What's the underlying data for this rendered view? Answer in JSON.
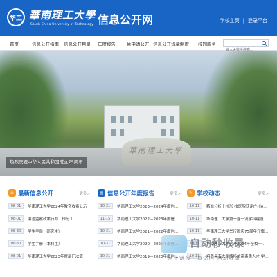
{
  "header": {
    "logo_seal_text": "华工",
    "logo_cn": "華南理工大學",
    "logo_en": "South China University of Technology",
    "site_title": "信息公开网",
    "links": [
      "学校主页",
      "登录平台"
    ],
    "color": "#1865c6"
  },
  "nav": {
    "items": [
      "首页",
      "信息公开指南",
      "信息公开目录",
      "年度报告",
      "依申请公开",
      "信息公开规章制度",
      "校园服务"
    ],
    "search_placeholder": "输入关键字搜索..."
  },
  "banner": {
    "caption": "热烈庆祝中华人民共和国成立75周年",
    "stone_text": "華南理工大學"
  },
  "sections": [
    {
      "title": "最新信息公开",
      "more": "更多>",
      "icon": "list-icon",
      "items": [
        {
          "date": "08-01",
          "text": "华南理工大学2024年教育收费公示"
        },
        {
          "date": "08-01",
          "text": "廉洁监察政策行为工作分工"
        },
        {
          "date": "08-30",
          "text": "学生手册（研究生）"
        },
        {
          "date": "08-30",
          "text": "学生手册（本科生）"
        },
        {
          "date": "08-01",
          "text": "华南理工大学2023年度部门决算"
        }
      ]
    },
    {
      "title": "信息公开年度报告",
      "more": "更多>",
      "icon": "report-icon",
      "items": [
        {
          "date": "10-31",
          "text": "华南理工大学2023—2024年度信息公开工作..."
        },
        {
          "date": "11-15",
          "text": "华南理工大学2022—2023年度信息公开工作..."
        },
        {
          "date": "10-31",
          "text": "华南理工大学2021—2022年度信息公开工作..."
        },
        {
          "date": "10-31",
          "text": "华南理工大学2020—2021年度信息公开工作..."
        },
        {
          "date": "10-31",
          "text": "华南理工大学2019—2020年度信息公开工作..."
        }
      ]
    },
    {
      "title": "学校动态",
      "more": "更多>",
      "icon": "news-icon",
      "items": [
        {
          "date": "10-11",
          "text": "精准分析土拉形 校医院获评广州64家..."
        },
        {
          "date": "10-11",
          "text": "华南理工大学第一届一流学科建设工作..."
        },
        {
          "date": "10-11",
          "text": "华南理工大学举行国庆75周年升旗仪式"
        },
        {
          "date": "10-11",
          "text": "华南理工大学召开2024年全校干部大会"
        },
        {
          "date": "10-11",
          "text": "培养具有大国情怀的高素质人才 学校举..."
        }
      ]
    }
  ],
  "watermark": {
    "title": "自动秒收录",
    "subtitle": "网上链接一直访问·自动收录"
  }
}
